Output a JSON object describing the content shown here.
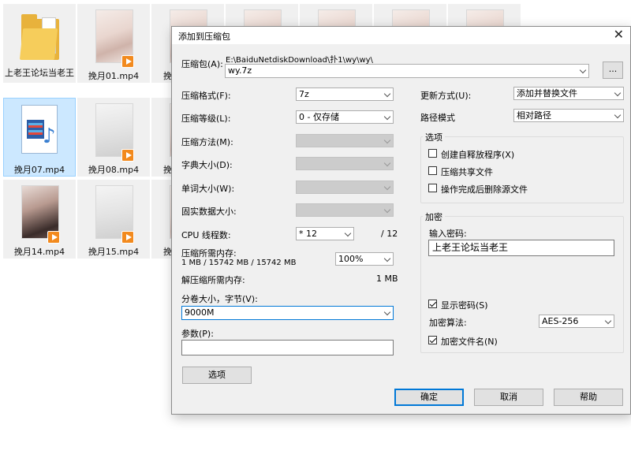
{
  "explorer": {
    "files": [
      {
        "label": "上老王论坛当老王",
        "kind": "folder"
      },
      {
        "label": "挽月01.mp4",
        "kind": "video"
      },
      {
        "label": "挽月07.mp4",
        "kind": "media",
        "selected": true
      },
      {
        "label": "挽月08.mp4",
        "kind": "video"
      },
      {
        "label": "挽月14.mp4",
        "kind": "video"
      },
      {
        "label": "挽月15.mp4",
        "kind": "video"
      },
      {
        "label": "挽",
        "kind": "partial"
      },
      {
        "label": "挽",
        "kind": "partial"
      },
      {
        "label": "挽",
        "kind": "partial"
      }
    ]
  },
  "dialog": {
    "title": "添加到压缩包",
    "archive": {
      "label": "压缩包(A):",
      "path": "E:\\BaiduNetdiskDownload\\扑1\\wy\\wy\\",
      "name": "wy.7z",
      "browse_label": "..."
    },
    "format": {
      "label": "压缩格式(F):",
      "value": "7z"
    },
    "level": {
      "label": "压缩等级(L):",
      "value": "0 - 仅存储"
    },
    "method": {
      "label": "压缩方法(M):",
      "value": ""
    },
    "dict": {
      "label": "字典大小(D):",
      "value": ""
    },
    "word": {
      "label": "单词大小(W):",
      "value": ""
    },
    "solid": {
      "label": "固实数据大小:",
      "value": ""
    },
    "threads": {
      "label": "CPU 线程数:",
      "value": "* 12",
      "max": "/ 12"
    },
    "mem_compress": {
      "label": "压缩所需内存:",
      "detail": "1 MB / 15742 MB / 15742 MB",
      "percent": "100%"
    },
    "mem_decompress": {
      "label": "解压缩所需内存:",
      "value": "1 MB"
    },
    "volume": {
      "label": "分卷大小，字节(V):",
      "value": "9000M"
    },
    "params": {
      "label": "参数(P):",
      "value": ""
    },
    "options_button": "选项",
    "update_mode": {
      "label": "更新方式(U):",
      "value": "添加并替换文件"
    },
    "path_mode": {
      "label": "路径模式",
      "value": "相对路径"
    },
    "options_group": {
      "title": "选项",
      "sfx": {
        "label": "创建自释放程序(X)",
        "checked": false
      },
      "shared": {
        "label": "压缩共享文件",
        "checked": false
      },
      "delete_after": {
        "label": "操作完成后删除源文件",
        "checked": false
      }
    },
    "encryption": {
      "title": "加密",
      "password_label": "输入密码:",
      "password": "上老王论坛当老王",
      "show_password": {
        "label": "显示密码(S)",
        "checked": true
      },
      "method_label": "加密算法:",
      "method": "AES-256",
      "encrypt_names": {
        "label": "加密文件名(N)",
        "checked": true
      }
    },
    "buttons": {
      "ok": "确定",
      "cancel": "取消",
      "help": "帮助"
    }
  }
}
